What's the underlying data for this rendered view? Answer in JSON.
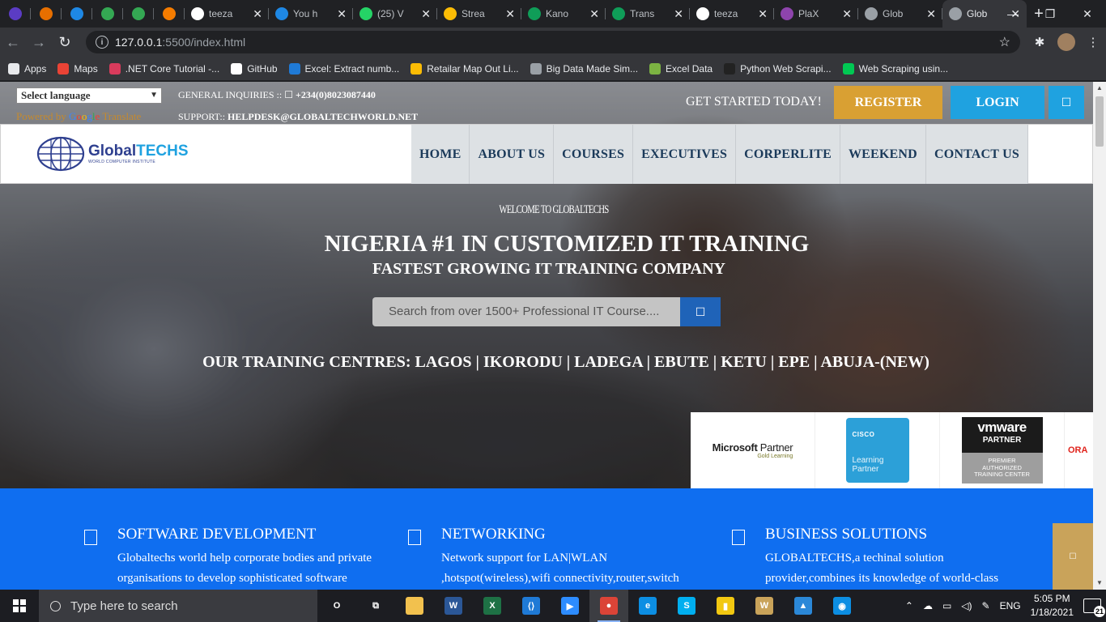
{
  "browser": {
    "tabs": [
      {
        "title": "",
        "icon": "flag-icon",
        "color": "#5b3cc4",
        "pinned": true
      },
      {
        "title": "",
        "icon": "java-icon",
        "color": "#e76f00",
        "pinned": true
      },
      {
        "title": "",
        "icon": "sync-icon",
        "color": "#1e88e5",
        "pinned": true
      },
      {
        "title": "",
        "icon": "loading-icon",
        "color": "#34a853",
        "pinned": true
      },
      {
        "title": "",
        "icon": "loading-icon",
        "color": "#34a853",
        "pinned": true
      },
      {
        "title": "",
        "icon": "app-icon",
        "color": "#f57c00",
        "pinned": true
      },
      {
        "title": "teeza",
        "icon": "github-icon",
        "color": "#ffffff",
        "pinned": false
      },
      {
        "title": "You h",
        "icon": "skype-icon",
        "color": "#1e88e5",
        "pinned": false
      },
      {
        "title": "(25) V",
        "icon": "whatsapp-icon",
        "color": "#25d366",
        "pinned": false
      },
      {
        "title": "Strea",
        "icon": "drive-icon",
        "color": "#fbbc05",
        "pinned": false
      },
      {
        "title": "Kano",
        "icon": "sheets-icon",
        "color": "#0f9d58",
        "pinned": false
      },
      {
        "title": "Trans",
        "icon": "sheets-icon",
        "color": "#0f9d58",
        "pinned": false
      },
      {
        "title": "teeza",
        "icon": "github-icon",
        "color": "#ffffff",
        "pinned": false
      },
      {
        "title": "PlaX",
        "icon": "plax-icon",
        "color": "#8e44ad",
        "pinned": false
      },
      {
        "title": "Glob",
        "icon": "globe-icon",
        "color": "#9aa0a6",
        "pinned": false
      },
      {
        "title": "Glob",
        "icon": "globe-icon",
        "color": "#9aa0a6",
        "pinned": false,
        "active": true
      }
    ],
    "url_host": "127.0.0.1",
    "url_path": ":5500/index.html",
    "bookmarks": [
      {
        "label": "Apps",
        "icon": "apps-grid-icon",
        "color": "#e8eaed"
      },
      {
        "label": "Maps",
        "icon": "maps-pin-icon",
        "color": "#ea4335"
      },
      {
        "label": ".NET Core Tutorial -...",
        "icon": "dotnet-icon",
        "color": "#d93b5c"
      },
      {
        "label": "GitHub",
        "icon": "github-icon",
        "color": "#ffffff"
      },
      {
        "label": "Excel: Extract numb...",
        "icon": "excel-a-icon",
        "color": "#1f7ad6"
      },
      {
        "label": "Retailar Map Out Li...",
        "icon": "drive-icon",
        "color": "#fbbc05"
      },
      {
        "label": "Big Data Made Sim...",
        "icon": "pen-icon",
        "color": "#9aa0a6"
      },
      {
        "label": "Excel Data",
        "icon": "excel-chart-icon",
        "color": "#7cb342"
      },
      {
        "label": "Python Web Scrapi...",
        "icon": "python-icon",
        "color": "#222222"
      },
      {
        "label": "Web Scraping usin...",
        "icon": "scrape-icon",
        "color": "#00c853"
      }
    ]
  },
  "topbar": {
    "language_select": "Select language",
    "powered_by": "Powered by",
    "google_word": [
      "G",
      "o",
      "o",
      "g",
      "l",
      "e"
    ],
    "translate": "Translate",
    "inquiries_label": "GENERAL INQUIRIES :: ",
    "phone_icon": "phone-icon",
    "inquiries_phone": "+234(0)8023087440",
    "support_label": "SUPPORT:: ",
    "support_email": "HELPDESK@GLOBALTECHWORLD.NET",
    "get_started": "GET STARTED TODAY!",
    "register": "REGISTER",
    "login": "LOGIN",
    "menu_icon": "menu-icon"
  },
  "logo": {
    "name_part1": "Global",
    "name_part2": "TECHS",
    "tagline": "WORLD COMPUTER INSTITUTE"
  },
  "nav": [
    "HOME",
    "ABOUT US",
    "COURSES",
    "EXECUTIVES",
    "CORPERLITE",
    "WEEKEND",
    "CONTACT US"
  ],
  "hero": {
    "welcome": "WELCOME TO GLOBALTECHS",
    "headline": "NIGERIA #1 IN CUSTOMIZED IT TRAINING",
    "subline": "FASTEST GROWING IT TRAINING COMPANY",
    "search_placeholder": "Search from over 1500+ Professional IT Course....",
    "centres": "OUR TRAINING CENTRES: LAGOS | IKORODU | LADEGA | EBUTE | KETU | EPE | ABUJA-(NEW)"
  },
  "partners": {
    "microsoft": {
      "brand": "Microsoft",
      "word": "Partner",
      "tier": "Gold Learning"
    },
    "cisco": {
      "brand": "CISCO",
      "line1": "Learning",
      "line2": "Partner"
    },
    "vmware": {
      "brand": "vmware",
      "line": "PARTNER",
      "sub1": "PREMIER",
      "sub2": "AUTHORIZED",
      "sub3": "TRAINING CENTER"
    },
    "oracle": "ORA"
  },
  "services": [
    {
      "title": "SOFTWARE DEVELOPMENT",
      "icon": "code-icon",
      "line1": "Globaltechs world help corporate bodies and private",
      "line2": "organisations to develop sophisticated software"
    },
    {
      "title": "NETWORKING",
      "icon": "network-icon",
      "line1": "Network support for LAN|WLAN",
      "line2": ",hotspot(wireless),wifi connectivity,router,switch"
    },
    {
      "title": "BUSINESS SOLUTIONS",
      "icon": "briefcase-icon",
      "line1": "GLOBALTECHS,a techinal solution",
      "line2": "provider,combines its knowledge of world-class"
    }
  ],
  "taskbar": {
    "search_placeholder": "Type here to search",
    "apps": [
      {
        "name": "cortana-icon",
        "color": "#1c1d22",
        "label": "O"
      },
      {
        "name": "task-view-icon",
        "color": "#1c1d22",
        "label": "⧉"
      },
      {
        "name": "file-explorer-icon",
        "color": "#f2c14e",
        "label": ""
      },
      {
        "name": "word-icon",
        "color": "#2b5797",
        "label": "W"
      },
      {
        "name": "excel-icon",
        "color": "#1e7145",
        "label": "X"
      },
      {
        "name": "vscode-icon",
        "color": "#1f7ad6",
        "label": "⟨⟩"
      },
      {
        "name": "zoom-icon",
        "color": "#2d8cff",
        "label": "▶"
      },
      {
        "name": "chrome-icon",
        "color": "#db4437",
        "label": "●",
        "active": true
      },
      {
        "name": "edge-icon",
        "color": "#0c8ee3",
        "label": "e"
      },
      {
        "name": "skype-icon",
        "color": "#00aff0",
        "label": "S"
      },
      {
        "name": "powerbi-icon",
        "color": "#f2c811",
        "label": "▮"
      },
      {
        "name": "wordpad-icon",
        "color": "#c9a35a",
        "label": "W"
      },
      {
        "name": "photos-icon",
        "color": "#2b88d8",
        "label": "▲"
      },
      {
        "name": "wifi-app-icon",
        "color": "#0c8ee3",
        "label": "◉"
      }
    ],
    "lang": "ENG",
    "time": "5:05 PM",
    "date": "1/18/2021",
    "notifications": "21"
  },
  "colors": {
    "register": "#d9a033",
    "login": "#1fa2e0",
    "search_button": "#1f63b8",
    "services_band": "#0f6ef0",
    "nav_text": "#1b3a5a"
  }
}
